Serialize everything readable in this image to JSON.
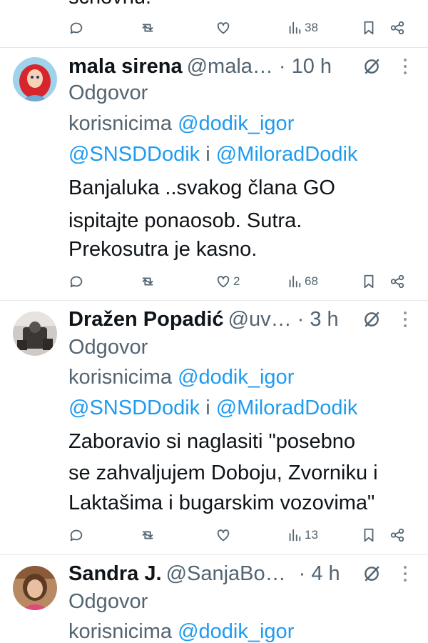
{
  "top": {
    "cut_text": "schovnu.",
    "views": "38"
  },
  "tweets": [
    {
      "name": "mala sirena",
      "handle": "@mala…",
      "time": "· 10 h",
      "reply_label": "Odgovor",
      "reply_prefix": "korisnicima",
      "mention1": "@dodik_igor",
      "mention2": "@SNSDDodik",
      "conj": "i",
      "mention3": "@MiloradDodik",
      "text_lines": [
        "Banjaluka ..svakog člana GO",
        "ispitajte ponaosob. Sutra.",
        "Prekosutra je kasno."
      ],
      "likes": "2",
      "views": "68"
    },
    {
      "name": "Dražen Popadić",
      "handle": "@uv…",
      "time": "· 3 h",
      "reply_label": "Odgovor",
      "reply_prefix": "korisnicima",
      "mention1": "@dodik_igor",
      "mention2": "@SNSDDodik",
      "conj": "i",
      "mention3": "@MiloradDodik",
      "text_lines": [
        "Zaboravio si naglasiti \"posebno",
        "se zahvaljujem Doboju, Zvorniku i",
        "Laktašima i bugarskim vozovima\""
      ],
      "likes": "",
      "views": "13"
    },
    {
      "name": "Sandra J.",
      "handle": "@SanjaBo…",
      "time": "· 4 h",
      "reply_label": "Odgovor",
      "reply_prefix": "korisnicima",
      "mention1": "@dodik_igor"
    }
  ],
  "colors": {
    "link": "#1d9bf0",
    "meta": "#536471",
    "text": "#0f1419",
    "divider": "#e4e8ec"
  },
  "icons": [
    "reply-icon",
    "retweet-icon",
    "like-icon",
    "views-icon",
    "bookmark-icon",
    "share-icon",
    "grok-icon",
    "more-icon"
  ]
}
